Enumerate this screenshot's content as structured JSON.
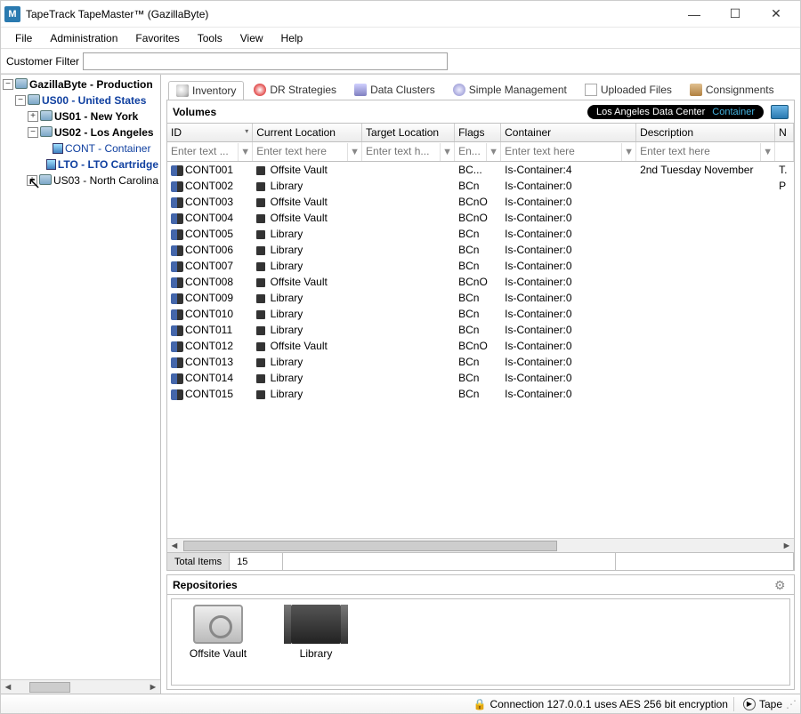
{
  "window": {
    "title": "TapeTrack TapeMaster™ (GazillaByte)",
    "app_icon_letter": "M"
  },
  "menu": [
    "File",
    "Administration",
    "Favorites",
    "Tools",
    "View",
    "Help"
  ],
  "filter": {
    "label": "Customer Filter",
    "value": ""
  },
  "tree": {
    "root": "GazillaByte - Production",
    "nodes": [
      {
        "label": "US00 - United States",
        "indent": 1,
        "bold": true,
        "blue": true,
        "toggle": "-"
      },
      {
        "label": "US01 - New York",
        "indent": 2,
        "bold": true,
        "toggle": "+"
      },
      {
        "label": "US02 - Los Angeles",
        "indent": 2,
        "bold": true,
        "toggle": "-"
      },
      {
        "label": "CONT - Container",
        "indent": 3,
        "blue": true,
        "media": true
      },
      {
        "label": "LTO - LTO Cartridge",
        "indent": 3,
        "bold": true,
        "blue": true,
        "media": true
      },
      {
        "label": "US03 - North Carolina",
        "indent": 2,
        "toggle": "+"
      }
    ]
  },
  "tabs": [
    {
      "label": "Inventory",
      "icon": "ti-inv",
      "active": true
    },
    {
      "label": "DR Strategies",
      "icon": "ti-dr"
    },
    {
      "label": "Data Clusters",
      "icon": "ti-dc"
    },
    {
      "label": "Simple Management",
      "icon": "ti-sm"
    },
    {
      "label": "Uploaded Files",
      "icon": "ti-up"
    },
    {
      "label": "Consignments",
      "icon": "ti-cn"
    }
  ],
  "volumes": {
    "title": "Volumes",
    "pill_location": "Los Angeles Data Center",
    "pill_container": "Container"
  },
  "columns": [
    "ID",
    "Current Location",
    "Target Location",
    "Flags",
    "Container",
    "Description",
    "N"
  ],
  "placeholders": {
    "id": "Enter text ...",
    "loc": "Enter text here",
    "target": "Enter text h...",
    "flags": "En...",
    "cont": "Enter text here",
    "desc": "Enter text here"
  },
  "rows": [
    {
      "id": "CONT001",
      "loc": "Offsite Vault",
      "flags": "BC...",
      "cont": "Is-Container:4",
      "desc": "2nd Tuesday November",
      "n": "T."
    },
    {
      "id": "CONT002",
      "loc": "Library",
      "flags": "BCn",
      "cont": "Is-Container:0",
      "desc": "",
      "n": "P"
    },
    {
      "id": "CONT003",
      "loc": "Offsite Vault",
      "flags": "BCnO",
      "cont": "Is-Container:0",
      "desc": "",
      "n": ""
    },
    {
      "id": "CONT004",
      "loc": "Offsite Vault",
      "flags": "BCnO",
      "cont": "Is-Container:0",
      "desc": "",
      "n": ""
    },
    {
      "id": "CONT005",
      "loc": "Library",
      "flags": "BCn",
      "cont": "Is-Container:0",
      "desc": "",
      "n": ""
    },
    {
      "id": "CONT006",
      "loc": "Library",
      "flags": "BCn",
      "cont": "Is-Container:0",
      "desc": "",
      "n": ""
    },
    {
      "id": "CONT007",
      "loc": "Library",
      "flags": "BCn",
      "cont": "Is-Container:0",
      "desc": "",
      "n": ""
    },
    {
      "id": "CONT008",
      "loc": "Offsite Vault",
      "flags": "BCnO",
      "cont": "Is-Container:0",
      "desc": "",
      "n": ""
    },
    {
      "id": "CONT009",
      "loc": "Library",
      "flags": "BCn",
      "cont": "Is-Container:0",
      "desc": "",
      "n": ""
    },
    {
      "id": "CONT010",
      "loc": "Library",
      "flags": "BCn",
      "cont": "Is-Container:0",
      "desc": "",
      "n": ""
    },
    {
      "id": "CONT011",
      "loc": "Library",
      "flags": "BCn",
      "cont": "Is-Container:0",
      "desc": "",
      "n": ""
    },
    {
      "id": "CONT012",
      "loc": "Offsite Vault",
      "flags": "BCnO",
      "cont": "Is-Container:0",
      "desc": "",
      "n": ""
    },
    {
      "id": "CONT013",
      "loc": "Library",
      "flags": "BCn",
      "cont": "Is-Container:0",
      "desc": "",
      "n": ""
    },
    {
      "id": "CONT014",
      "loc": "Library",
      "flags": "BCn",
      "cont": "Is-Container:0",
      "desc": "",
      "n": ""
    },
    {
      "id": "CONT015",
      "loc": "Library",
      "flags": "BCn",
      "cont": "Is-Container:0",
      "desc": "",
      "n": ""
    }
  ],
  "totals": {
    "label": "Total Items",
    "count": "15"
  },
  "repositories": {
    "title": "Repositories",
    "items": [
      {
        "label": "Offsite Vault",
        "kind": "vault"
      },
      {
        "label": "Library",
        "kind": "library"
      }
    ]
  },
  "status": {
    "connection": "Connection 127.0.0.1 uses AES 256 bit encryption",
    "tape": "Tape"
  }
}
